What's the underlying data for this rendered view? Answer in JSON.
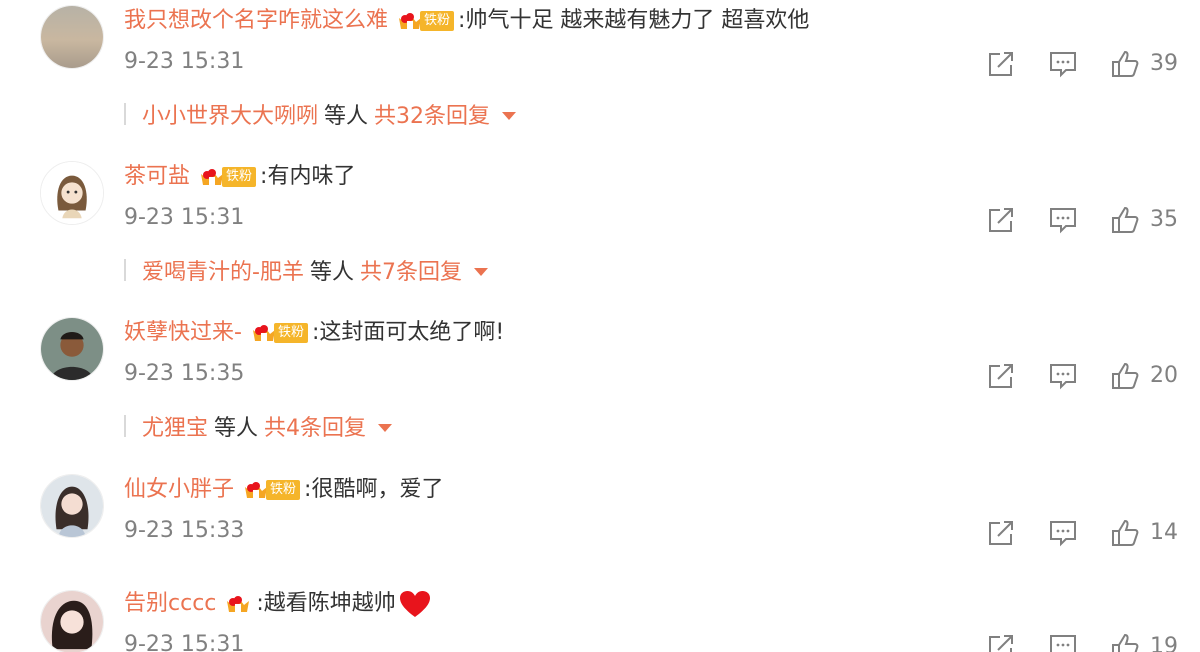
{
  "comments": [
    {
      "username": "我只想改个名字咋就这么难",
      "badge": "铁粉",
      "text": ":帅气十足 越来越有魅力了 超喜欢他",
      "time": "9-23 15:31",
      "likes": "39",
      "reply_user": "小小世界大大咧咧",
      "reply_etc": "等人",
      "reply_total": "共32条回复"
    },
    {
      "username": "茶可盐",
      "badge": "铁粉",
      "text": ":有内味了",
      "time": "9-23 15:31",
      "likes": "35",
      "reply_user": "爱喝青汁的-肥羊",
      "reply_etc": "等人",
      "reply_total": "共7条回复"
    },
    {
      "username": "妖孽快过来-",
      "badge": "铁粉",
      "text": ":这封面可太绝了啊!",
      "time": "9-23 15:35",
      "likes": "20",
      "reply_user": "尤狸宝",
      "reply_etc": "等人",
      "reply_total": "共4条回复"
    },
    {
      "username": "仙女小胖子",
      "badge": "铁粉",
      "text": ":很酷啊，爱了",
      "time": "9-23 15:33",
      "likes": "14"
    },
    {
      "username": "告别cccc",
      "text": ":越看陈坤越帅",
      "time": "9-23 15:31",
      "likes": "19"
    }
  ],
  "icons": {
    "share": "share-icon",
    "comment": "comment-icon",
    "like": "thumbs-up-icon",
    "crown": "crown-icon",
    "heart": "heart-icon",
    "caret": "caret-down-icon"
  },
  "colors": {
    "username": "#eb7350",
    "text": "#333333",
    "meta": "#808080",
    "badge": "#f5b52a",
    "heart": "#e8141c"
  }
}
